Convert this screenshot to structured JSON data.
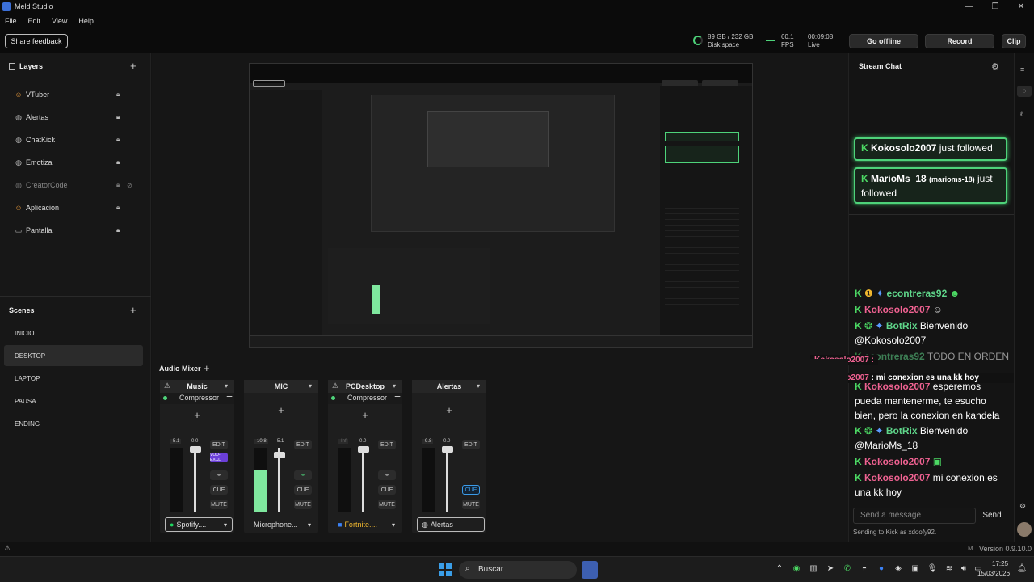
{
  "window": {
    "title": "Meld Studio",
    "minimize": "—",
    "maximize": "❐",
    "close": "✕"
  },
  "menu": [
    "File",
    "Edit",
    "View",
    "Help"
  ],
  "topbar": {
    "share_feedback": "Share feedback",
    "disk_value": "89 GB / 232 GB",
    "disk_label": "Disk space",
    "fps_value": "60.1",
    "fps_label": "FPS",
    "time_value": "00:09:08",
    "time_label": "Live",
    "go_offline": "Go offline",
    "record": "Record",
    "clip": "Clip"
  },
  "layers": {
    "header": "Layers",
    "add": "+",
    "items": [
      {
        "label": "VTuber",
        "icon": "vtuber-icon",
        "muted": false
      },
      {
        "label": "Alertas",
        "icon": "globe-icon",
        "muted": false
      },
      {
        "label": "ChatKick",
        "icon": "globe-icon",
        "muted": false
      },
      {
        "label": "Emotiza",
        "icon": "globe-icon",
        "muted": false
      },
      {
        "label": "CreatorCode",
        "icon": "globe-icon",
        "muted": true
      },
      {
        "label": "Aplicacion",
        "icon": "vtuber-icon",
        "muted": false
      },
      {
        "label": "Pantalla",
        "icon": "monitor-icon",
        "muted": false
      }
    ]
  },
  "scenes": {
    "header": "Scenes",
    "add": "+",
    "items": [
      "INICIO",
      "DESKTOP",
      "LAPTOP",
      "PAUSA",
      "ENDING"
    ],
    "active": "DESKTOP"
  },
  "chat": {
    "header": "Stream Chat",
    "follows": [
      {
        "name": "Kokosolo2007",
        "text": "just followed"
      },
      {
        "name": "MarioMs_18",
        "tag": "(marioms-18)",
        "text": "just followed"
      }
    ],
    "messages": [
      {
        "name": "econtreras92",
        "text": "",
        "color": "g"
      },
      {
        "name": "Kokosolo2007",
        "text": "",
        "color": "p"
      },
      {
        "name": "BotRix",
        "text": "Bienvenido @Kokosolo2007",
        "color": "g"
      },
      {
        "name": "econtreras92",
        "text": "TODO EN ORDEN",
        "color": "g"
      },
      {
        "name": "Kokosolo2007",
        "text": "esperemos pueda mantenerme, te esucho bien, pero la conexion en kandela",
        "color": "p"
      },
      {
        "name": "BotRix",
        "text": "Bienvenido @MarioMs_18",
        "color": "g"
      },
      {
        "name": "Kokosolo2007",
        "text": "",
        "color": "p"
      },
      {
        "name": "Kokosolo2007",
        "text": "mi conexion es una kk hoy",
        "color": "p"
      }
    ],
    "tooltip_1": "Kokosolo2007 :",
    "tooltip_2_name": "Kokosolo2007",
    "tooltip_2_text": ": mi conexion es una kk hoy",
    "input_placeholder": "Send a message",
    "send": "Send",
    "sending_to": "Sending to Kick as xdoofy92."
  },
  "mixer": {
    "header": "Audio Mixer",
    "add": "+",
    "channels": [
      {
        "title": "Music",
        "sub": "Compressor",
        "db1": "-5.1",
        "db2": "0.0",
        "edit": "EDIT",
        "tag": "VOD-EXCL",
        "cue": "CUE",
        "mute": "MUTE",
        "source": "Spotify....",
        "level": 0.0
      },
      {
        "title": "MIC",
        "sub": "",
        "db1": "-10.8",
        "db2": "-5.1",
        "edit": "EDIT",
        "tag": "",
        "cue": "CUE",
        "mute": "MUTE",
        "source": "Microphone...",
        "level": 0.65
      },
      {
        "title": "PCDesktop",
        "sub": "Compressor",
        "db1": "-Inf",
        "db2": "0.0",
        "edit": "EDIT",
        "tag": "",
        "cue": "CUE",
        "mute": "MUTE",
        "source": "Fortnite....",
        "level": 0.0
      },
      {
        "title": "Alertas",
        "sub": "",
        "db1": "-9.8",
        "db2": "0.0",
        "edit": "EDIT",
        "tag": "",
        "cue": "CUE",
        "mute": "MUTE",
        "source": "Alertas",
        "level": 0.0
      }
    ]
  },
  "status": {
    "version": "Version 0.9.10.0"
  },
  "taskbar": {
    "search": "Buscar",
    "time": "17:25",
    "date": "15/03/2026"
  },
  "colors": {
    "accent_green": "#4ed37a",
    "pink_name": "#f06292",
    "bg": "#141414"
  }
}
